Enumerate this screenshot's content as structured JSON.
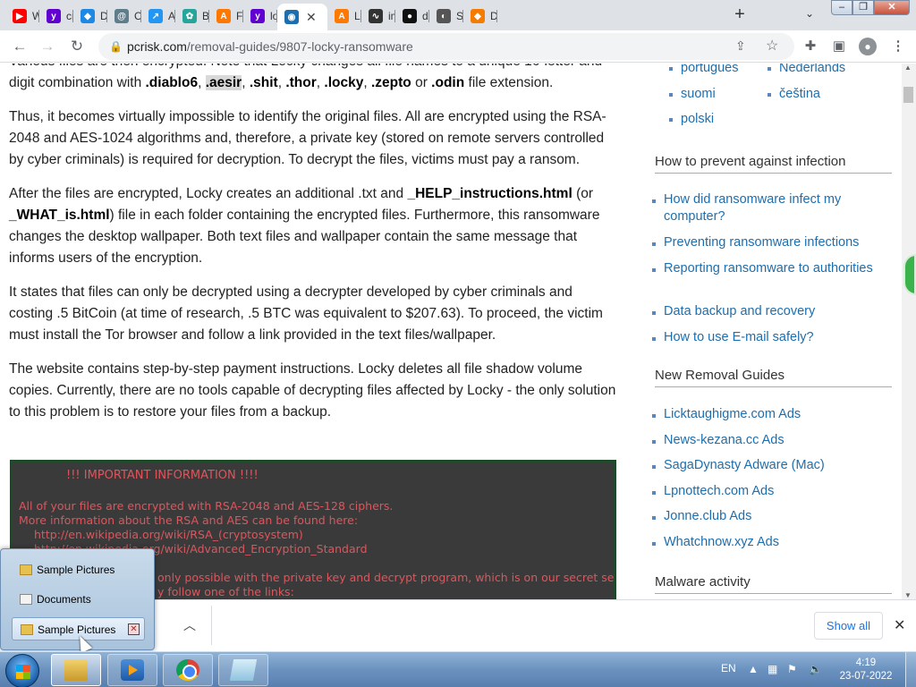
{
  "tabs": [
    {
      "label": "Wi",
      "icon": "youtube-icon",
      "color": "#ff0000"
    },
    {
      "label": "cry",
      "icon": "yahoo-icon",
      "color": "#6001d2"
    },
    {
      "label": "Do",
      "icon": "diamond-icon",
      "color": "#1e88e5"
    },
    {
      "label": "Cry",
      "icon": "swirl-icon",
      "color": "#607d8b"
    },
    {
      "label": "Ast",
      "icon": "chart-icon",
      "color": "#2196f3"
    },
    {
      "label": "Buy",
      "icon": "gear-icon",
      "color": "#26a69a"
    },
    {
      "label": "Fre",
      "icon": "avast-icon",
      "color": "#ff7800"
    },
    {
      "label": "loc",
      "icon": "yahoo-icon",
      "color": "#6001d2"
    },
    {
      "label": "",
      "icon": "pcrisk-icon",
      "color": "#1d6eae",
      "active": true
    },
    {
      "label": "Loc",
      "icon": "avast-icon",
      "color": "#ff7800"
    },
    {
      "label": "ima",
      "icon": "wave-icon",
      "color": "#333333"
    },
    {
      "label": "dec",
      "icon": "github-icon",
      "color": "#111111"
    },
    {
      "label": "Site",
      "icon": "globe-icon",
      "color": "#555555"
    },
    {
      "label": "De",
      "icon": "diamond-icon",
      "color": "#f57c00"
    }
  ],
  "toolbar": {
    "url_host": "pcrisk.com",
    "url_path": "/removal-guides/9807-locky-ransomware"
  },
  "article": {
    "p1_start": "Various files are then encrypted. Note that Locky changes all file names to a unique 16-letter and digit combination with ",
    "ext1": ".diablo6",
    "ext2": ".aesir",
    "ext3": ".shit",
    "ext4": ".thor",
    "ext5": ".locky",
    "ext6": ".zepto",
    "p1_or": " or ",
    "ext7": ".odin",
    "p1_end": " file extension.",
    "p2": "Thus, it becomes virtually impossible to identify the original files. All are encrypted using the RSA-2048 and AES-1024 algorithms and, therefore, a private key (stored on remote servers controlled by cyber criminals) is required for decryption. To decrypt the files, victims must pay a ransom.",
    "p3_a": "After the files are encrypted, Locky creates an additional .txt and ",
    "p3_file1": "_HELP_instructions.html",
    "p3_b": " (or ",
    "p3_file2": "_WHAT_is.html",
    "p3_c": ") file in each folder containing the encrypted files. Furthermore, this ransomware changes the desktop wallpaper. Both text files and wallpaper contain the same message that informs users of the encryption.",
    "p4": "It states that files can only be decrypted using a decrypter developed by cyber criminals and costing .5 BitCoin (at time of research, .5 BTC was equivalent to $207.63). To proceed, the victim must install the Tor browser and follow a link provided in the text files/wallpaper.",
    "p5": "The website contains step-by-step payment instructions. Locky deletes all file shadow volume copies. Currently, there are no tools capable of decrypting files affected by Locky - the only solution to this problem is to restore your files from a backup."
  },
  "ransom_note": {
    "title": "!!! IMPORTANT INFORMATION !!!!",
    "line1": "All of your files are encrypted with RSA-2048 and AES-128 ciphers.",
    "line2": "More information about the RSA and AES can be found here:",
    "link1": "http://en.wikipedia.org/wiki/RSA_(cryptosystem)",
    "link2": "http://en.wikipedia.org/wiki/Advanced_Encryption_Standard",
    "line3": "only possible with the private key and decrypt program, which is on our secret server.",
    "line4": "y follow one of the links:"
  },
  "sidebar": {
    "languages": [
      "português",
      "Nederlands",
      "suomi",
      "čeština",
      "polski"
    ],
    "prevent_heading": "How to prevent against infection",
    "prevent_links": [
      "How did ransomware infect my computer?",
      "Preventing ransomware infections",
      "Reporting ransomware to authorities",
      "Data backup and recovery",
      "How to use E-mail safely?"
    ],
    "new_heading": "New Removal Guides",
    "new_links": [
      "Licktaughigme.com Ads",
      "News-kezana.cc Ads",
      "SagaDynasty Adware (Mac)",
      "Lpnottech.com Ads",
      "Jonne.club Ads",
      "Whatchnow.xyz Ads"
    ],
    "malware_heading": "Malware activity"
  },
  "download_bar": {
    "show_all": "Show all"
  },
  "jump_list": {
    "items": [
      "Sample Pictures",
      "Documents",
      "Sample Pictures"
    ]
  },
  "taskbar": {
    "language": "EN",
    "time": "4:19",
    "date": "23-07-2022"
  }
}
